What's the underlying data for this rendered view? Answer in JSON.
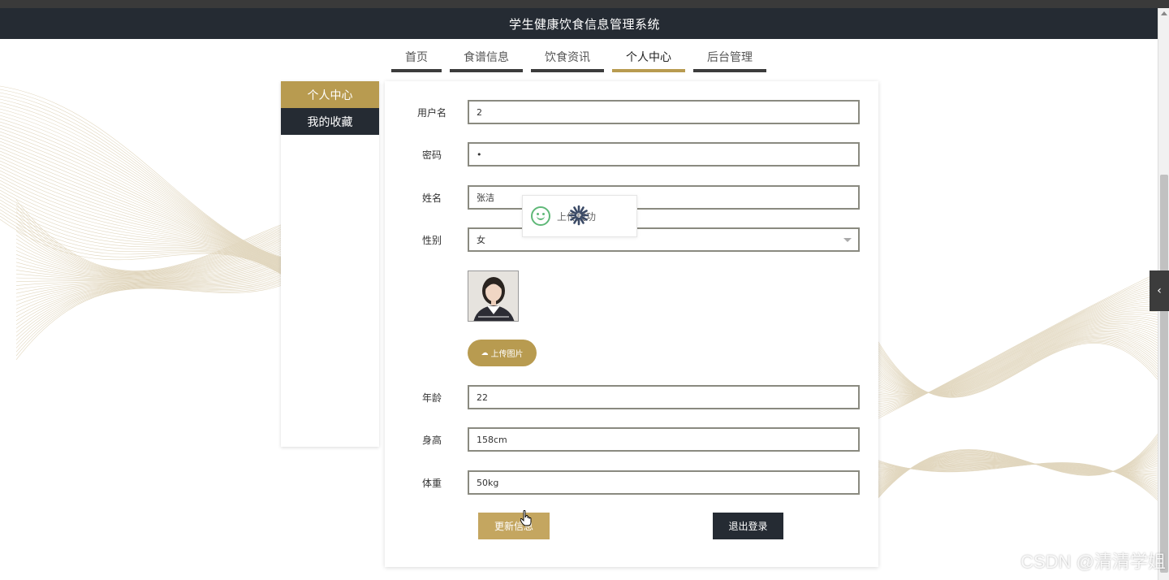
{
  "header": {
    "title": "学生健康饮食信息管理系统"
  },
  "nav": {
    "items": [
      {
        "label": "首页"
      },
      {
        "label": "食谱信息"
      },
      {
        "label": "饮食资讯"
      },
      {
        "label": "个人中心"
      },
      {
        "label": "后台管理"
      }
    ],
    "active_index": 3
  },
  "sidebar": {
    "items": [
      {
        "label": "个人中心"
      },
      {
        "label": "我的收藏"
      }
    ]
  },
  "form": {
    "username": {
      "label": "用户名",
      "value": "2"
    },
    "password": {
      "label": "密码",
      "value": "•"
    },
    "name": {
      "label": "姓名",
      "value": "张洁"
    },
    "gender": {
      "label": "性别",
      "value": "女"
    },
    "upload_label": "上传图片",
    "age": {
      "label": "年龄",
      "value": "22"
    },
    "height": {
      "label": "身高",
      "value": "158cm"
    },
    "weight": {
      "label": "体重",
      "value": "50kg"
    },
    "update_label": "更新信息",
    "logout_label": "退出登录"
  },
  "toast": {
    "text": "上传成功"
  },
  "watermark": "CSDN @清清学姐",
  "colors": {
    "accent": "#b89b50",
    "dark": "#252b33",
    "success": "#5fb878"
  },
  "icons": [
    "chevron-left-icon",
    "cloud-upload-icon",
    "smile-icon",
    "loading-spinner-icon",
    "hand-cursor-icon"
  ]
}
